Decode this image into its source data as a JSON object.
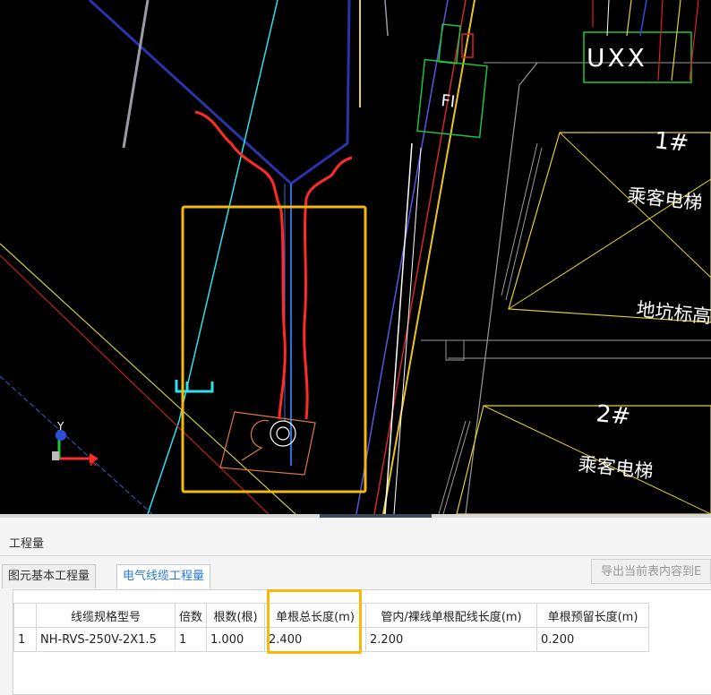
{
  "canvas": {
    "labels": {
      "elevator1_num": "1#",
      "elevator1_name": "乘客电梯",
      "pit_label": "地坑标高",
      "elevator2_num": "2#",
      "elevator2_name": "乘客电梯",
      "fi": "FI",
      "uxx": "UXX",
      "axis_y": "Y",
      "axis_x": "X"
    }
  },
  "panel": {
    "title": "工程量",
    "tabs": [
      {
        "label": "图元基本工程量",
        "active": false
      },
      {
        "label": "电气线缆工程量",
        "active": true
      }
    ],
    "export_label": "导出当前表内容到E",
    "table": {
      "headers": [
        "",
        "线缆规格型号",
        "倍数",
        "根数(根)",
        "单根总长度(m)",
        "管内/裸线单根配线长度(m)",
        "单根预留长度(m)"
      ],
      "rows": [
        [
          "1",
          "NH-RVS-250V-2X1.5",
          "1",
          "1.000",
          "2.400",
          "2.200",
          "0.200"
        ]
      ]
    }
  }
}
